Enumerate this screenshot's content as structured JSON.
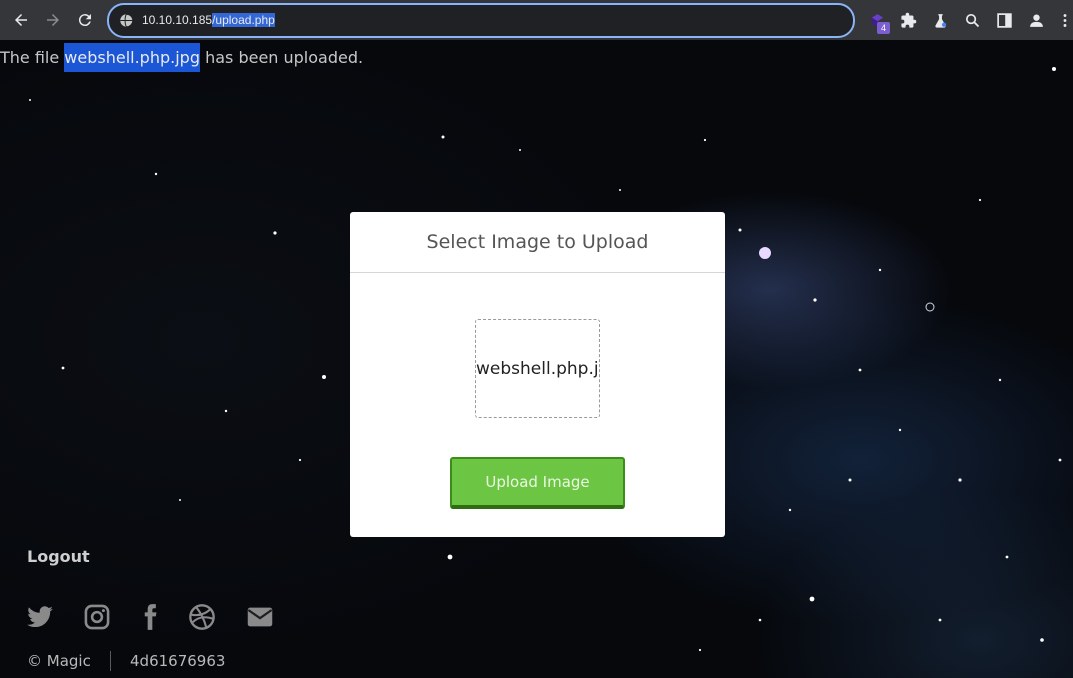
{
  "browser": {
    "url_host": "10.10.10.185",
    "url_path": "/upload.php",
    "extension_badge": "4",
    "icons": {
      "back": "back-arrow-icon",
      "forward": "forward-arrow-icon",
      "reload": "reload-icon",
      "site_info": "globe-icon",
      "extension_1": "extension-icon",
      "extensions": "puzzle-icon",
      "labs": "flask-icon",
      "search": "search-icon",
      "side_panel": "side-panel-icon",
      "profile": "profile-icon",
      "menu": "more-vertical-icon"
    },
    "accent_color": "#8ab4f8"
  },
  "page": {
    "upload_message": {
      "prefix": "The file ",
      "filename": "webshell.php.jpg",
      "suffix": " has been uploaded."
    },
    "upload_card": {
      "title": "Select Image to Upload",
      "selected_file": "webshell.php.jpg",
      "button_label": "Upload Image",
      "button_color": "#6cc644"
    },
    "footer": {
      "logout_label": "Logout",
      "social_icons": [
        "twitter-icon",
        "instagram-icon",
        "facebook-icon",
        "dribbble-icon",
        "envelope-icon"
      ],
      "copyright": "© Magic",
      "hex_text": "4d61676963"
    }
  }
}
